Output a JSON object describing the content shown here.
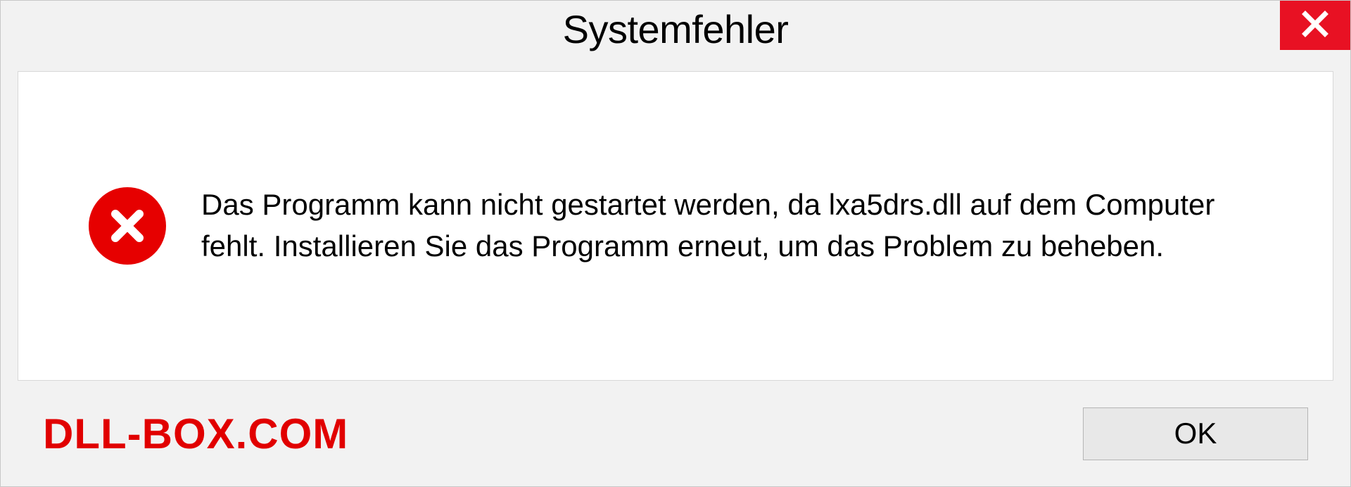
{
  "dialog": {
    "title": "Systemfehler",
    "message": "Das Programm kann nicht gestartet werden, da lxa5drs.dll auf dem Computer fehlt. Installieren Sie das Programm erneut, um das Problem zu beheben.",
    "ok_label": "OK"
  },
  "watermark": "DLL-BOX.COM",
  "colors": {
    "close_button": "#e81123",
    "error_icon": "#e60000",
    "watermark": "#e10000",
    "panel_bg": "#ffffff",
    "dialog_bg": "#f2f2f2"
  }
}
